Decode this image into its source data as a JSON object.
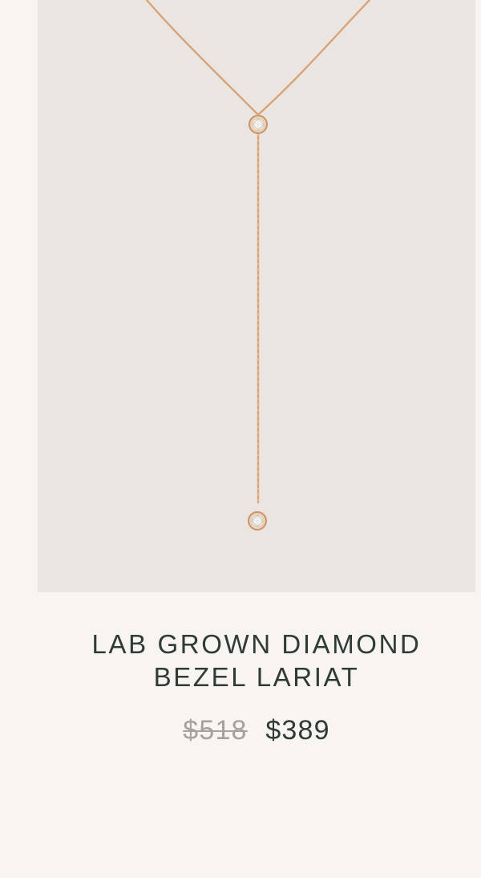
{
  "product": {
    "image_alt": "Lab Grown Diamond Bezel Lariat necklace",
    "title_line_1": "LAB GROWN DIAMOND",
    "title_line_2": "BEZEL LARIAT",
    "original_price": "$518",
    "sale_price": "$389"
  },
  "colors": {
    "page_background": "#f8f4f1",
    "image_background": "#ebe5e2",
    "title_text": "#2f3b34",
    "original_price_text": "#a5a19e",
    "chain_gold": "#d8a173"
  }
}
